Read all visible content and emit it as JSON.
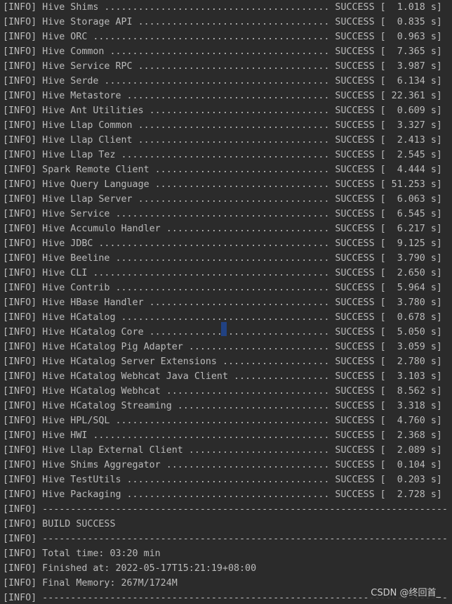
{
  "console": {
    "lines": [
      "[INFO] Hive Shims ........................................ SUCCESS [  1.018 s]",
      "[INFO] Hive Storage API .................................. SUCCESS [  0.835 s]",
      "[INFO] Hive ORC .......................................... SUCCESS [  0.963 s]",
      "[INFO] Hive Common ....................................... SUCCESS [  7.365 s]",
      "[INFO] Hive Service RPC .................................. SUCCESS [  3.987 s]",
      "[INFO] Hive Serde ........................................ SUCCESS [  6.134 s]",
      "[INFO] Hive Metastore .................................... SUCCESS [ 22.361 s]",
      "[INFO] Hive Ant Utilities ................................ SUCCESS [  0.609 s]",
      "[INFO] Hive Llap Common .................................. SUCCESS [  3.327 s]",
      "[INFO] Hive Llap Client .................................. SUCCESS [  2.413 s]",
      "[INFO] Hive Llap Tez ..................................... SUCCESS [  2.545 s]",
      "[INFO] Spark Remote Client ............................... SUCCESS [  4.444 s]",
      "[INFO] Hive Query Language ............................... SUCCESS [ 51.253 s]",
      "[INFO] Hive Llap Server .................................. SUCCESS [  6.063 s]",
      "[INFO] Hive Service ...................................... SUCCESS [  6.545 s]",
      "[INFO] Hive Accumulo Handler ............................. SUCCESS [  6.217 s]",
      "[INFO] Hive JDBC ......................................... SUCCESS [  9.125 s]",
      "[INFO] Hive Beeline ...................................... SUCCESS [  3.790 s]",
      "[INFO] Hive CLI .......................................... SUCCESS [  2.650 s]",
      "[INFO] Hive Contrib ...................................... SUCCESS [  5.964 s]",
      "[INFO] Hive HBase Handler ................................ SUCCESS [  3.780 s]",
      "[INFO] Hive HCatalog ..................................... SUCCESS [  0.678 s]",
      "[INFO] Hive HCatalog Core ................................ SUCCESS [  5.050 s]",
      "[INFO] Hive HCatalog Pig Adapter ......................... SUCCESS [  3.059 s]",
      "[INFO] Hive HCatalog Server Extensions ................... SUCCESS [  2.780 s]",
      "[INFO] Hive HCatalog Webhcat Java Client ................. SUCCESS [  3.103 s]",
      "[INFO] Hive HCatalog Webhcat ............................. SUCCESS [  8.562 s]",
      "[INFO] Hive HCatalog Streaming ........................... SUCCESS [  3.318 s]",
      "[INFO] Hive HPL/SQL ...................................... SUCCESS [  4.760 s]",
      "[INFO] Hive HWI .......................................... SUCCESS [  2.368 s]",
      "[INFO] Hive Llap External Client ......................... SUCCESS [  2.089 s]",
      "[INFO] Hive Shims Aggregator ............................. SUCCESS [  0.104 s]",
      "[INFO] Hive TestUtils .................................... SUCCESS [  0.203 s]",
      "[INFO] Hive Packaging .................................... SUCCESS [  2.728 s]",
      "[INFO] ------------------------------------------------------------------------",
      "[INFO] BUILD SUCCESS",
      "[INFO] ------------------------------------------------------------------------",
      "[INFO] Total time: 03:20 min",
      "[INFO] Finished at: 2022-05-17T15:21:19+08:00",
      "[INFO] Final Memory: 267M/1724M",
      "[INFO] ------------------------------------------------------------------------"
    ]
  },
  "watermark": "CSDN @终回首_",
  "colors": {
    "background": "#2b2b2b",
    "text": "#bbbbbb",
    "selection": "#214283"
  }
}
